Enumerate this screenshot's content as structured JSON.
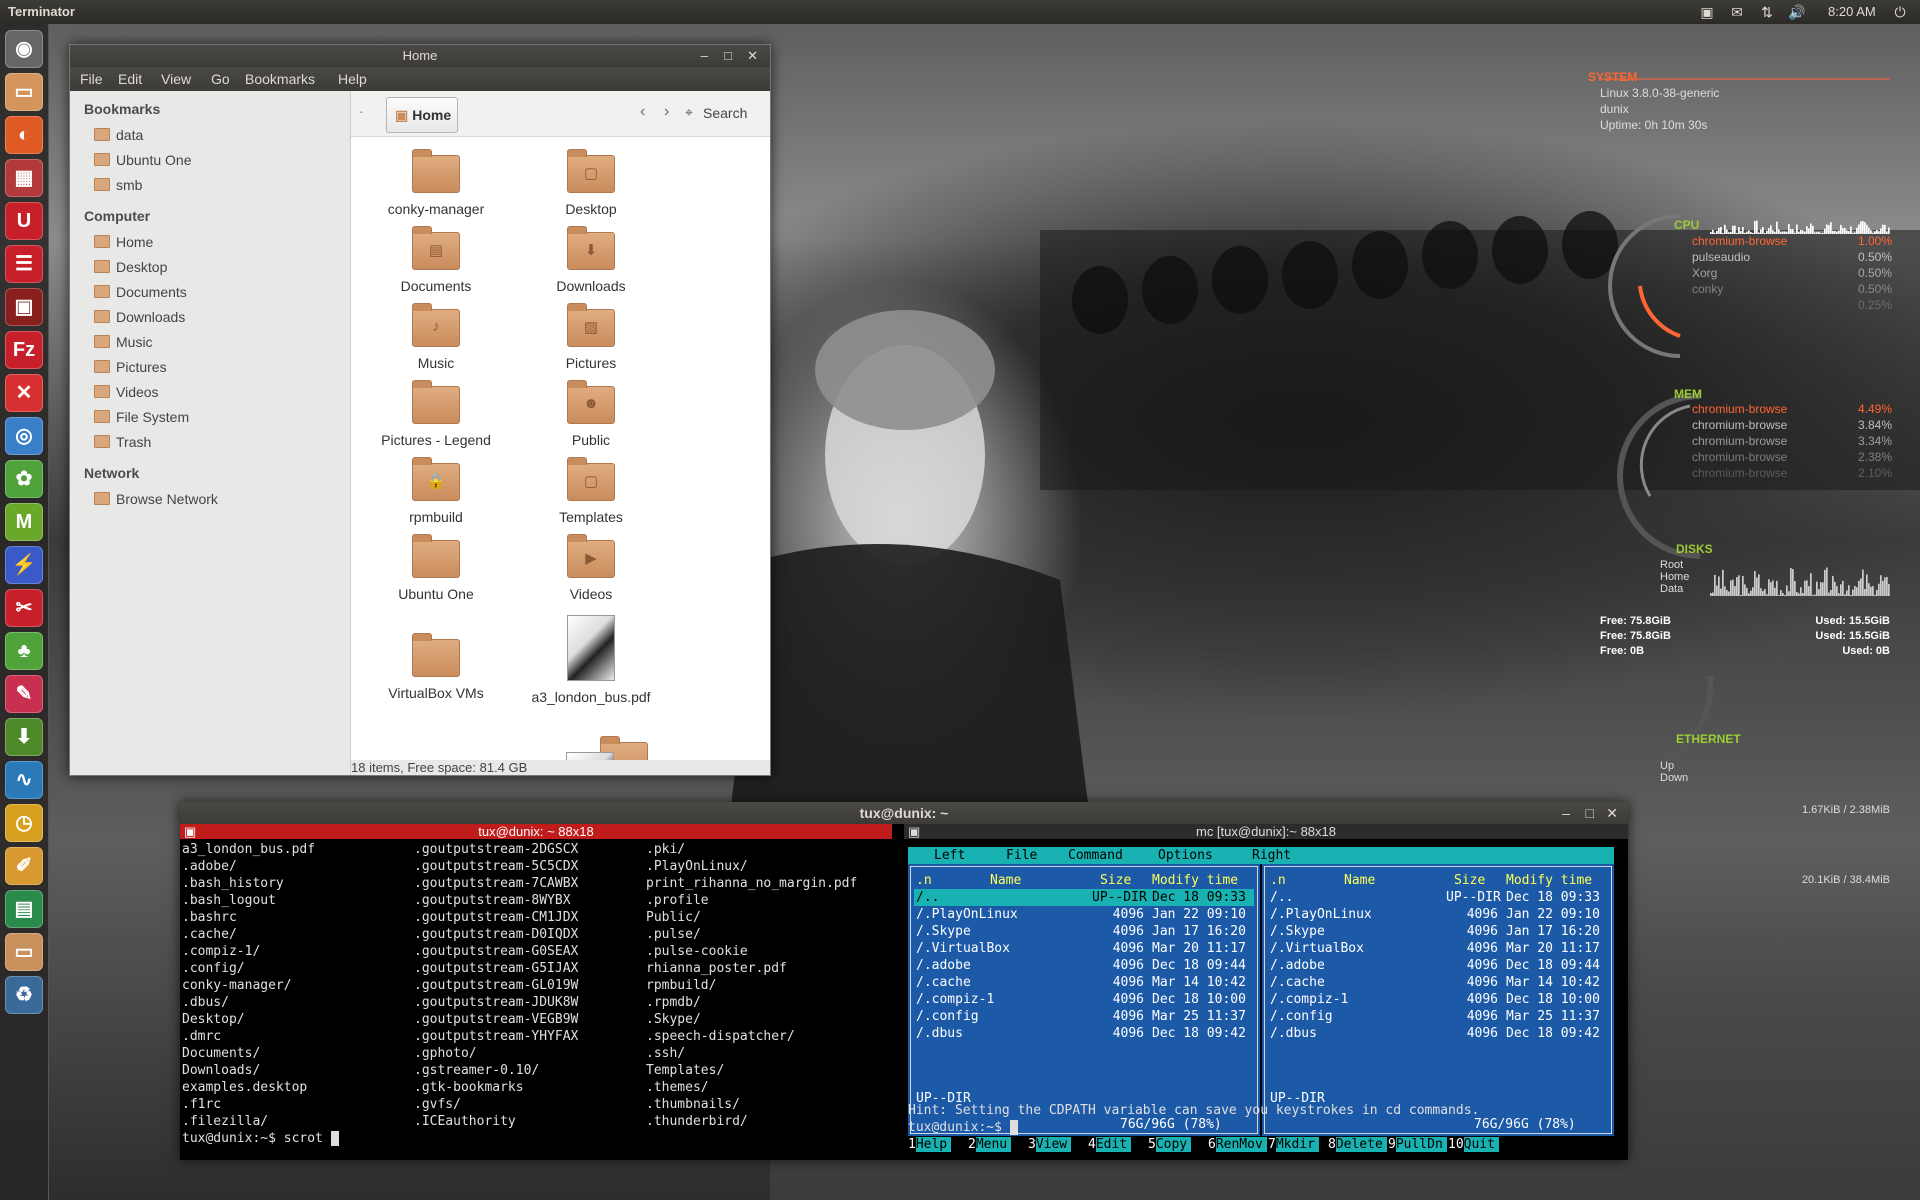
{
  "top_panel": {
    "app_title": "Terminator",
    "clock": "8:20 AM"
  },
  "launcher": {
    "icons": [
      {
        "name": "dash-home-icon",
        "glyph": "◉",
        "color": "#666666"
      },
      {
        "name": "files-icon",
        "glyph": "▭",
        "color": "#d4955c"
      },
      {
        "name": "firefox-icon",
        "glyph": "◐",
        "color": "#e05a24"
      },
      {
        "name": "apps-icon",
        "glyph": "▦",
        "color": "#b33a3a"
      },
      {
        "name": "ubuntu-one-icon",
        "glyph": "U",
        "color": "#c8202a"
      },
      {
        "name": "settings-icon",
        "glyph": "☰",
        "color": "#c8202a"
      },
      {
        "name": "terminal-icon",
        "glyph": "▣",
        "color": "#8a1f1f"
      },
      {
        "name": "filezilla-icon",
        "glyph": "Fz",
        "color": "#c8202a"
      },
      {
        "name": "close-app-icon",
        "glyph": "✕",
        "color": "#d83030"
      },
      {
        "name": "chromium-icon",
        "glyph": "◎",
        "color": "#3a80c8"
      },
      {
        "name": "flower-icon",
        "glyph": "✿",
        "color": "#4fa33a"
      },
      {
        "name": "m-app-icon",
        "glyph": "M",
        "color": "#6aa82a"
      },
      {
        "name": "network-tool-icon",
        "glyph": "⚡",
        "color": "#3a5ac8"
      },
      {
        "name": "tools-icon",
        "glyph": "✂",
        "color": "#c8202a"
      },
      {
        "name": "clover-icon",
        "glyph": "♣",
        "color": "#4fa33a"
      },
      {
        "name": "brush-icon",
        "glyph": "✎",
        "color": "#c83050"
      },
      {
        "name": "download-icon",
        "glyph": "⬇",
        "color": "#4f8a2a"
      },
      {
        "name": "monitor-icon",
        "glyph": "∿",
        "color": "#2a7ab8"
      },
      {
        "name": "clock-app-icon",
        "glyph": "◷",
        "color": "#d8a020"
      },
      {
        "name": "editor-icon",
        "glyph": "✐",
        "color": "#d89a30"
      },
      {
        "name": "spreadsheet-icon",
        "glyph": "▤",
        "color": "#2a8a4a"
      },
      {
        "name": "files2-icon",
        "glyph": "▭",
        "color": "#c8905c"
      },
      {
        "name": "trash-icon",
        "glyph": "♻",
        "color": "#3a6a9a"
      }
    ]
  },
  "file_manager": {
    "title": "Home",
    "menu": [
      "File",
      "Edit",
      "View",
      "Go",
      "Bookmarks",
      "Help"
    ],
    "sidebar": {
      "sections": [
        {
          "title": "Bookmarks",
          "items": [
            "data",
            "Ubuntu One",
            "smb"
          ]
        },
        {
          "title": "Computer",
          "items": [
            "Home",
            "Desktop",
            "Documents",
            "Downloads",
            "Music",
            "Pictures",
            "Videos",
            "File System",
            "Trash"
          ]
        },
        {
          "title": "Network",
          "items": [
            "Browse Network"
          ]
        }
      ]
    },
    "path": "Home",
    "search_label": "Search",
    "items": [
      {
        "name": "conky-manager",
        "emblem": ""
      },
      {
        "name": "Desktop",
        "emblem": "▢"
      },
      {
        "name": "Documents",
        "emblem": "▤"
      },
      {
        "name": "Downloads",
        "emblem": "⬇"
      },
      {
        "name": "Music",
        "emblem": "♪"
      },
      {
        "name": "Pictures",
        "emblem": "▨"
      },
      {
        "name": "Pictures - Legend",
        "emblem": ""
      },
      {
        "name": "Public",
        "emblem": "☻"
      },
      {
        "name": "rpmbuild",
        "emblem": "🔒"
      },
      {
        "name": "Templates",
        "emblem": "▢"
      },
      {
        "name": "Ubuntu One",
        "emblem": ""
      },
      {
        "name": "Videos",
        "emblem": "▶"
      },
      {
        "name": "VirtualBox VMs",
        "emblem": ""
      },
      {
        "name": "a3_london_bus.pdf",
        "emblem": ""
      }
    ],
    "status": "18 items, Free space: 81.4 GB"
  },
  "terminal": {
    "window_title": "tux@dunix: ~",
    "left_title": "tux@dunix: ~ 88x18",
    "right_title": "mc [tux@dunix]:~ 88x18",
    "ls_col1": [
      "a3_london_bus.pdf",
      ".adobe/",
      ".bash_history",
      ".bash_logout",
      ".bashrc",
      ".cache/",
      ".compiz-1/",
      ".config/",
      "conky-manager/",
      ".dbus/",
      "Desktop/",
      ".dmrc",
      "Documents/",
      "Downloads/",
      "examples.desktop",
      ".f1rc",
      ".filezilla/"
    ],
    "ls_col2": [
      ".goutputstream-2DGSCX",
      ".goutputstream-5C5CDX",
      ".goutputstream-7CAWBX",
      ".goutputstream-8WYBX",
      ".goutputstream-CM1JDX",
      ".goutputstream-D0IQDX",
      ".goutputstream-G0SEAX",
      ".goutputstream-G5IJAX",
      ".goutputstream-GL019W",
      ".goutputstream-JDUK8W",
      ".goutputstream-VEGB9W",
      ".goutputstream-YHYFAX",
      ".gphoto/",
      ".gstreamer-0.10/",
      ".gtk-bookmarks",
      ".gvfs/",
      ".ICEauthority"
    ],
    "ls_col3": [
      ".pki/",
      ".PlayOnLinux/",
      "print_rihanna_no_margin.pdf",
      ".profile",
      "Public/",
      ".pulse/",
      ".pulse-cookie",
      "rhianna_poster.pdf",
      "rpmbuild/",
      ".rpmdb/",
      ".Skype/",
      ".speech-dispatcher/",
      ".ssh/",
      "Templates/",
      ".themes/",
      ".thumbnails/",
      ".thunderbird/"
    ],
    "prompt": "tux@dunix:~$ scrot ",
    "mc": {
      "menu": [
        "Left",
        "File",
        "Command",
        "Options",
        "Right"
      ],
      "headers": {
        "n": ".n",
        "name": "Name",
        "size": "Size",
        "mtime": "Modify time"
      },
      "rows": [
        {
          "name": "/..",
          "size": "UP--DIR",
          "date": "Dec 18 09:33"
        },
        {
          "name": "/.PlayOnLinux",
          "size": "4096",
          "date": "Jan 22 09:10"
        },
        {
          "name": "/.Skype",
          "size": "4096",
          "date": "Jan 17 16:20"
        },
        {
          "name": "/.VirtualBox",
          "size": "4096",
          "date": "Mar 20 11:17"
        },
        {
          "name": "/.adobe",
          "size": "4096",
          "date": "Dec 18 09:44"
        },
        {
          "name": "/.cache",
          "size": "4096",
          "date": "Mar 14 10:42"
        },
        {
          "name": "/.compiz-1",
          "size": "4096",
          "date": "Dec 18 10:00"
        },
        {
          "name": "/.config",
          "size": "4096",
          "date": "Mar 25 11:37"
        },
        {
          "name": "/.dbus",
          "size": "4096",
          "date": "Dec 18 09:42"
        }
      ],
      "footer_left": "UP--DIR",
      "footer_right": "76G/96G (78%)",
      "hint": "Hint: Setting the CDPATH variable can save you keystrokes in cd commands.",
      "prompt": "tux@dunix:~$ ",
      "fkeys": [
        [
          "1",
          "Help"
        ],
        [
          "2",
          "Menu"
        ],
        [
          "3",
          "View"
        ],
        [
          "4",
          "Edit"
        ],
        [
          "5",
          "Copy"
        ],
        [
          "6",
          "RenMov"
        ],
        [
          "7",
          "Mkdir"
        ],
        [
          "8",
          "Delete"
        ],
        [
          "9",
          "PullDn"
        ],
        [
          "10",
          "Quit"
        ]
      ]
    }
  },
  "conky": {
    "system_head": "SYSTEM",
    "kernel": "Linux 3.8.0-38-generic",
    "host": "dunix",
    "uptime": "Uptime: 0h 10m 30s",
    "cpu_head": "CPU",
    "cpu_procs": [
      [
        "chromium-browse",
        "1.00%"
      ],
      [
        "pulseaudio",
        "0.50%"
      ],
      [
        "Xorg",
        "0.50%"
      ],
      [
        "conky",
        "0.50%"
      ],
      [
        "",
        "0.25%"
      ]
    ],
    "mem_head": "MEM",
    "mem_procs": [
      [
        "chromium-browse",
        "4.49%"
      ],
      [
        "chromium-browse",
        "3.84%"
      ],
      [
        "chromium-browse",
        "3.34%"
      ],
      [
        "chromium-browse",
        "2.38%"
      ],
      [
        "chromium-browse",
        "2.10%"
      ]
    ],
    "disks_head": "DISKS",
    "disk_labels": [
      "Root",
      "Home",
      "Data"
    ],
    "disk_free": [
      "Free: 75.8GiB",
      "Free: 75.8GiB",
      "Free: 0B"
    ],
    "disk_used": [
      "Used: 15.5GiB",
      "Used: 15.5GiB",
      "Used: 0B"
    ],
    "eth_head": "ETHERNET",
    "eth_labels": [
      "Up",
      "Down"
    ],
    "up_rate": "1.67KiB / 2.38MiB",
    "down_rate": "20.1KiB / 38.4MiB"
  }
}
